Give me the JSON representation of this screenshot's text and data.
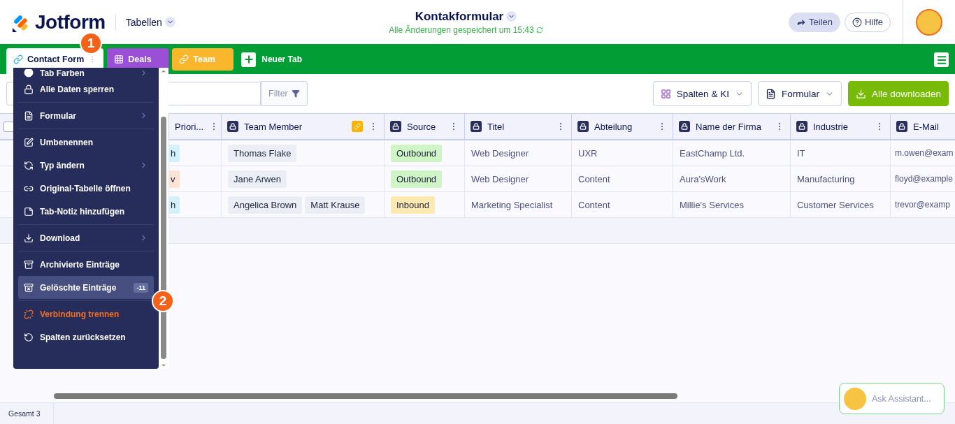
{
  "header": {
    "brand": "Jotform",
    "section": "Tabellen",
    "title": "Kontakformular",
    "save_status": "Alle Änderungen gespeichert um 15:43",
    "buttons": [
      {
        "label": "Teilen",
        "kind": "share"
      },
      {
        "label": "Hilfe",
        "kind": "help"
      }
    ]
  },
  "tabs": [
    {
      "label": "Contact Form",
      "selected": true,
      "kind": "link",
      "color": "#ffffff"
    },
    {
      "label": "Deals",
      "selected": false,
      "kind": "grid",
      "color": "#9b4fd6"
    },
    {
      "label": "Team",
      "selected": false,
      "kind": "link",
      "color": "#fbb62c"
    }
  ],
  "new_tab": "Neuer Tab",
  "step_markers": [
    "1",
    "2"
  ],
  "toolbar": {
    "filter": "Filter",
    "buttons": [
      {
        "label": "Spalten & KI",
        "kind": "columns"
      },
      {
        "label": "Formular",
        "kind": "form"
      },
      {
        "label": "Alle downloaden",
        "kind": "download"
      }
    ]
  },
  "table": {
    "all_checked": false,
    "columns": [
      {
        "label": "Priori...",
        "linked": false
      },
      {
        "label": "Team Member",
        "linked": true
      },
      {
        "label": "Source",
        "linked": false
      },
      {
        "label": "Titel",
        "linked": false
      },
      {
        "label": "Abteilung",
        "linked": false
      },
      {
        "label": "Name der Firma",
        "linked": false
      },
      {
        "label": "Industrie",
        "linked": false
      },
      {
        "label": "E-Mail",
        "linked": false
      }
    ],
    "rows": [
      {
        "cells": [
          {
            "kind": "chip",
            "text": "h",
            "color": "#d4f1fb"
          },
          {
            "kind": "tags",
            "values": [
              "Thomas Flake"
            ]
          },
          {
            "kind": "chip",
            "text": "Outbound",
            "color": "#cff5c6"
          },
          {
            "kind": "text",
            "text": "Web Designer"
          },
          {
            "kind": "text",
            "text": "UXR"
          },
          {
            "kind": "text",
            "text": "EastChamp Ltd."
          },
          {
            "kind": "text",
            "text": "IT"
          },
          {
            "kind": "text",
            "text": "m.owen@exam"
          }
        ]
      },
      {
        "cells": [
          {
            "kind": "chip",
            "text": "v",
            "color": "#fde3d6"
          },
          {
            "kind": "tags",
            "values": [
              "Jane Arwen"
            ]
          },
          {
            "kind": "chip",
            "text": "Outbound",
            "color": "#cff5c6"
          },
          {
            "kind": "text",
            "text": "Web Designer"
          },
          {
            "kind": "text",
            "text": "Content"
          },
          {
            "kind": "text",
            "text": "Aura'sWork"
          },
          {
            "kind": "text",
            "text": "Manufacturing"
          },
          {
            "kind": "text",
            "text": "floyd@example"
          }
        ]
      },
      {
        "cells": [
          {
            "kind": "chip",
            "text": "h",
            "color": "#d4f1fb"
          },
          {
            "kind": "tags",
            "values": [
              "Angelica Brown",
              "Matt Krause"
            ]
          },
          {
            "kind": "chip",
            "text": "Inbound",
            "color": "#feeab0"
          },
          {
            "kind": "text",
            "text": "Marketing Specialist"
          },
          {
            "kind": "text",
            "text": "Content"
          },
          {
            "kind": "text",
            "text": "Millie's Services"
          },
          {
            "kind": "text",
            "text": "Customer Services"
          },
          {
            "kind": "text",
            "text": "trevor@examp"
          }
        ]
      }
    ]
  },
  "menu": {
    "groups": [
      [
        {
          "label": "Tab Farben",
          "kind": "color",
          "submenu": true,
          "selected": false
        },
        {
          "label": "Alle Daten sperren",
          "kind": "lock",
          "submenu": false,
          "selected": false
        }
      ],
      [
        {
          "label": "Formular",
          "kind": "form",
          "submenu": true,
          "selected": false
        }
      ],
      [
        {
          "label": "Umbenennen",
          "kind": "rename",
          "submenu": false,
          "selected": false
        },
        {
          "label": "Typ ändern",
          "kind": "type",
          "submenu": true,
          "selected": false
        },
        {
          "label": "Original-Tabelle öffnen",
          "kind": "link",
          "submenu": false,
          "selected": false
        },
        {
          "label": "Tab-Notiz hinzufügen",
          "kind": "note",
          "submenu": false,
          "selected": false
        }
      ],
      [
        {
          "label": "Download",
          "kind": "download",
          "submenu": true,
          "selected": false
        }
      ],
      [
        {
          "label": "Archivierte Einträge",
          "kind": "archive",
          "submenu": false,
          "selected": false
        },
        {
          "label": "Gelöschte Einträge",
          "kind": "trash",
          "submenu": false,
          "selected": true,
          "badge": "-11"
        }
      ],
      [
        {
          "label": "Verbindung trennen",
          "kind": "disconnect",
          "submenu": false,
          "selected": false
        },
        {
          "label": "Spalten zurücksetzen",
          "kind": "reset",
          "submenu": false,
          "selected": false
        }
      ]
    ]
  },
  "footer": {
    "total": "Gesamt 3",
    "assistant": "Ask Assistant..."
  }
}
